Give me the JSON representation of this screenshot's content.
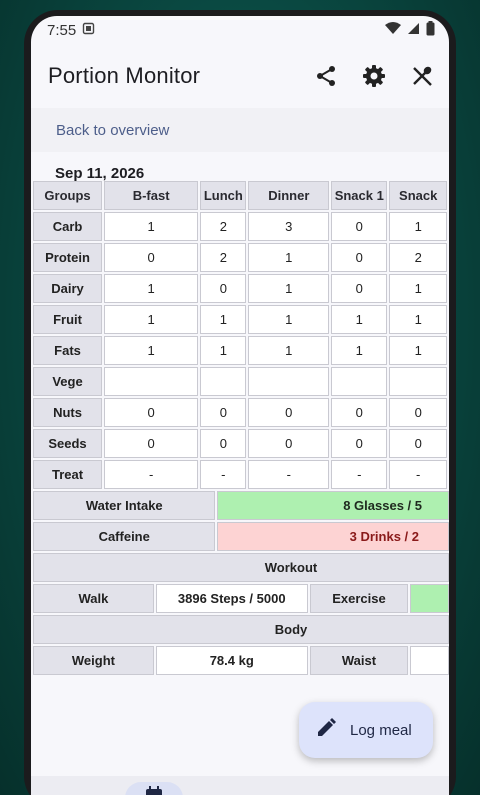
{
  "status": {
    "time": "7:55"
  },
  "app": {
    "title": "Portion Monitor"
  },
  "icons": {
    "share": "share-icon",
    "settings": "gear-icon",
    "tools": "utensils-icon",
    "edit": "pencil-icon",
    "calendar": "calendar-icon"
  },
  "nav": {
    "back_label": "Back to overview"
  },
  "date": "Sep 11, 2026",
  "table": {
    "headers": [
      "Groups",
      "B-fast",
      "Lunch",
      "Dinner",
      "Snack 1",
      "Snack"
    ],
    "rows": [
      {
        "group": "Carb",
        "values": [
          "1",
          "2",
          "3",
          "0",
          "1"
        ]
      },
      {
        "group": "Protein",
        "values": [
          "0",
          "2",
          "1",
          "0",
          "2"
        ]
      },
      {
        "group": "Dairy",
        "values": [
          "1",
          "0",
          "1",
          "0",
          "1"
        ]
      },
      {
        "group": "Fruit",
        "values": [
          "1",
          "1",
          "1",
          "1",
          "1"
        ]
      },
      {
        "group": "Fats",
        "values": [
          "1",
          "1",
          "1",
          "1",
          "1"
        ]
      },
      {
        "group": "Vege",
        "values": [
          "",
          "",
          "",
          "",
          ""
        ]
      },
      {
        "group": "Nuts",
        "values": [
          "0",
          "0",
          "0",
          "0",
          "0"
        ]
      },
      {
        "group": "Seeds",
        "values": [
          "0",
          "0",
          "0",
          "0",
          "0"
        ]
      },
      {
        "group": "Treat",
        "values": [
          "-",
          "-",
          "-",
          "-",
          "-"
        ]
      }
    ]
  },
  "water": {
    "label": "Water Intake",
    "value": "8 Glasses / 5"
  },
  "caffeine": {
    "label": "Caffeine",
    "value": "3 Drinks / 2"
  },
  "workout": {
    "header": "Workout",
    "walk_label": "Walk",
    "walk_value": "3896 Steps / 5000",
    "exercise_label": "Exercise"
  },
  "body": {
    "header": "Body",
    "weight_label": "Weight",
    "weight_value": "78.4 kg",
    "waist_label": "Waist"
  },
  "fab": {
    "label": "Log meal"
  },
  "colors": {
    "accent": "#4d5e8a",
    "good": "#aef0b0",
    "over": "#fdd3d3",
    "fab": "#dde3fb"
  }
}
